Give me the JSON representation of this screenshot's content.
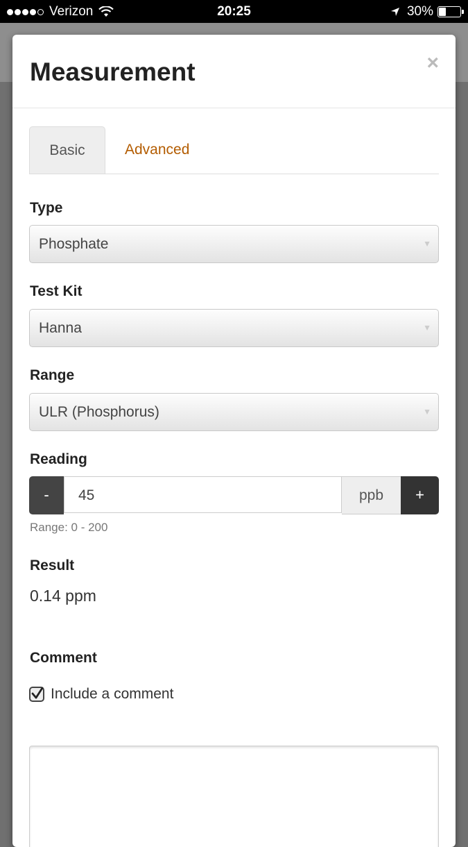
{
  "status_bar": {
    "carrier": "Verizon",
    "time": "20:25",
    "battery": "30%"
  },
  "modal": {
    "title": "Measurement",
    "close_label": "×",
    "tabs": [
      {
        "label": "Basic",
        "active": true
      },
      {
        "label": "Advanced",
        "active": false
      }
    ],
    "type": {
      "label": "Type",
      "value": "Phosphate"
    },
    "test_kit": {
      "label": "Test Kit",
      "value": "Hanna"
    },
    "range": {
      "label": "Range",
      "value": "ULR (Phosphorus)"
    },
    "reading": {
      "label": "Reading",
      "minus_label": "-",
      "value": "45",
      "unit": "ppb",
      "plus_label": "+",
      "hint": "Range: 0 - 200"
    },
    "result": {
      "label": "Result",
      "value": "0.14 ppm"
    },
    "comment": {
      "label": "Comment",
      "checkbox_label": "Include a comment",
      "checked": true,
      "text": ""
    }
  },
  "colors": {
    "link": "#b35c00",
    "dark_button": "#333333",
    "overlay": "#707070"
  },
  "icons": [
    "wifi-icon",
    "location-icon",
    "battery-icon",
    "close-icon",
    "dropdown-arrow-icon",
    "checkmark-icon"
  ]
}
